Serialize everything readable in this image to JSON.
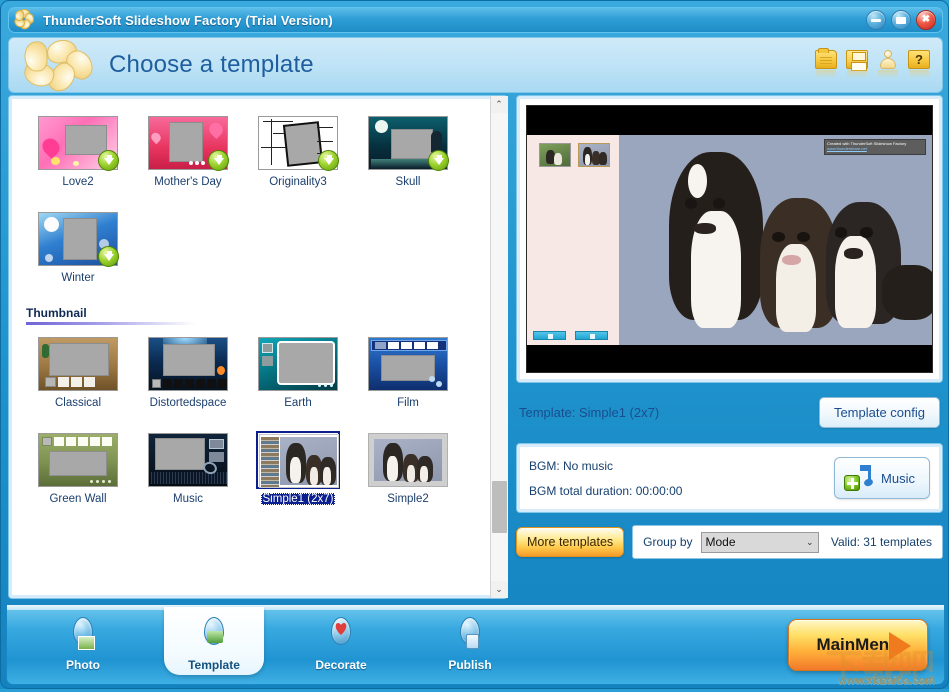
{
  "window": {
    "title": "ThunderSoft Slideshow Factory (Trial Version)",
    "minimize_label": "–",
    "restore_label": "▭",
    "close_label": "✕"
  },
  "header": {
    "title": "Choose a template",
    "tools": [
      {
        "name": "open-folder-icon",
        "label": ""
      },
      {
        "name": "save-icon",
        "label": ""
      },
      {
        "name": "user-icon",
        "label": ""
      },
      {
        "name": "help-icon",
        "label": "?"
      }
    ]
  },
  "template_list": {
    "groups": [
      {
        "heading": "",
        "items": [
          {
            "name": "Love2",
            "downloadable": true,
            "selected": false
          },
          {
            "name": "Mother's Day",
            "downloadable": true,
            "selected": false
          },
          {
            "name": "Originality3",
            "downloadable": true,
            "selected": false
          },
          {
            "name": "Skull",
            "downloadable": true,
            "selected": false
          },
          {
            "name": "Winter",
            "downloadable": true,
            "selected": false
          }
        ]
      },
      {
        "heading": "Thumbnail",
        "items": [
          {
            "name": "Classical",
            "downloadable": false,
            "selected": false
          },
          {
            "name": "Distortedspace",
            "downloadable": false,
            "selected": false
          },
          {
            "name": "Earth",
            "downloadable": false,
            "selected": false
          },
          {
            "name": "Film",
            "downloadable": false,
            "selected": false
          },
          {
            "name": "Green Wall",
            "downloadable": false,
            "selected": false
          },
          {
            "name": "Music",
            "downloadable": false,
            "selected": false
          },
          {
            "name": "Simple1 (2x7)",
            "downloadable": false,
            "selected": true
          },
          {
            "name": "Simple2",
            "downloadable": false,
            "selected": false
          }
        ]
      }
    ],
    "scrollbar": {
      "up_arrow": "⌃",
      "down_arrow": "⌄"
    }
  },
  "preview": {
    "watermark_line1": "Created with ThunderSoft Slideshow Factory",
    "watermark_line2": "www.thundershare.net",
    "template_label": "Template: Simple1 (2x7)",
    "config_button": "Template config"
  },
  "bgm": {
    "status": "BGM: No music",
    "duration": "BGM total duration: 00:00:00",
    "music_button": "Music"
  },
  "bottom_controls": {
    "more_templates": "More templates",
    "group_by_label": "Group by",
    "group_by_value": "Mode",
    "group_by_chevron": "⌄",
    "valid_text": "Valid: 31 templates"
  },
  "nav": {
    "items": [
      {
        "label": "Photo",
        "active": false
      },
      {
        "label": "Template",
        "active": true
      },
      {
        "label": "Decorate",
        "active": false
      },
      {
        "label": "Publish",
        "active": false
      }
    ],
    "main_menu": "MainMenu"
  },
  "overlay": {
    "watermark_glyph": "下载吧",
    "watermark_url": "www.xiazaiba.com"
  },
  "colors": {
    "accent": "#1e92cc",
    "selection": "#0b1f8f",
    "header_title": "#1f5e9e",
    "gold": "#f6c83f"
  }
}
